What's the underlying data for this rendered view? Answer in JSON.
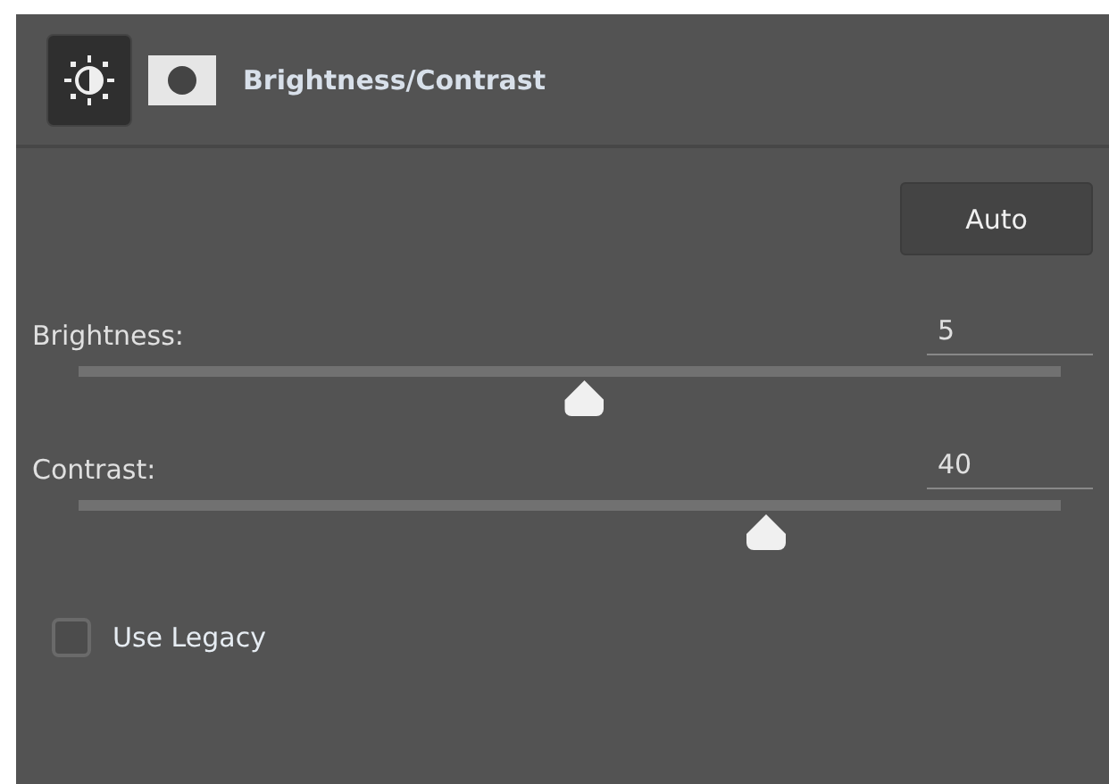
{
  "header": {
    "title": "Brightness/Contrast",
    "icons": [
      {
        "kind": "adjustment",
        "selected": true
      },
      {
        "kind": "mask",
        "selected": false
      }
    ]
  },
  "auto_button": {
    "label": "Auto"
  },
  "sliders": [
    {
      "label": "Brightness:",
      "value": "5",
      "level": 0.515
    },
    {
      "label": "Contrast:",
      "value": "40",
      "level": 0.7
    }
  ],
  "use_legacy": {
    "label": "Use Legacy",
    "checked": false
  }
}
